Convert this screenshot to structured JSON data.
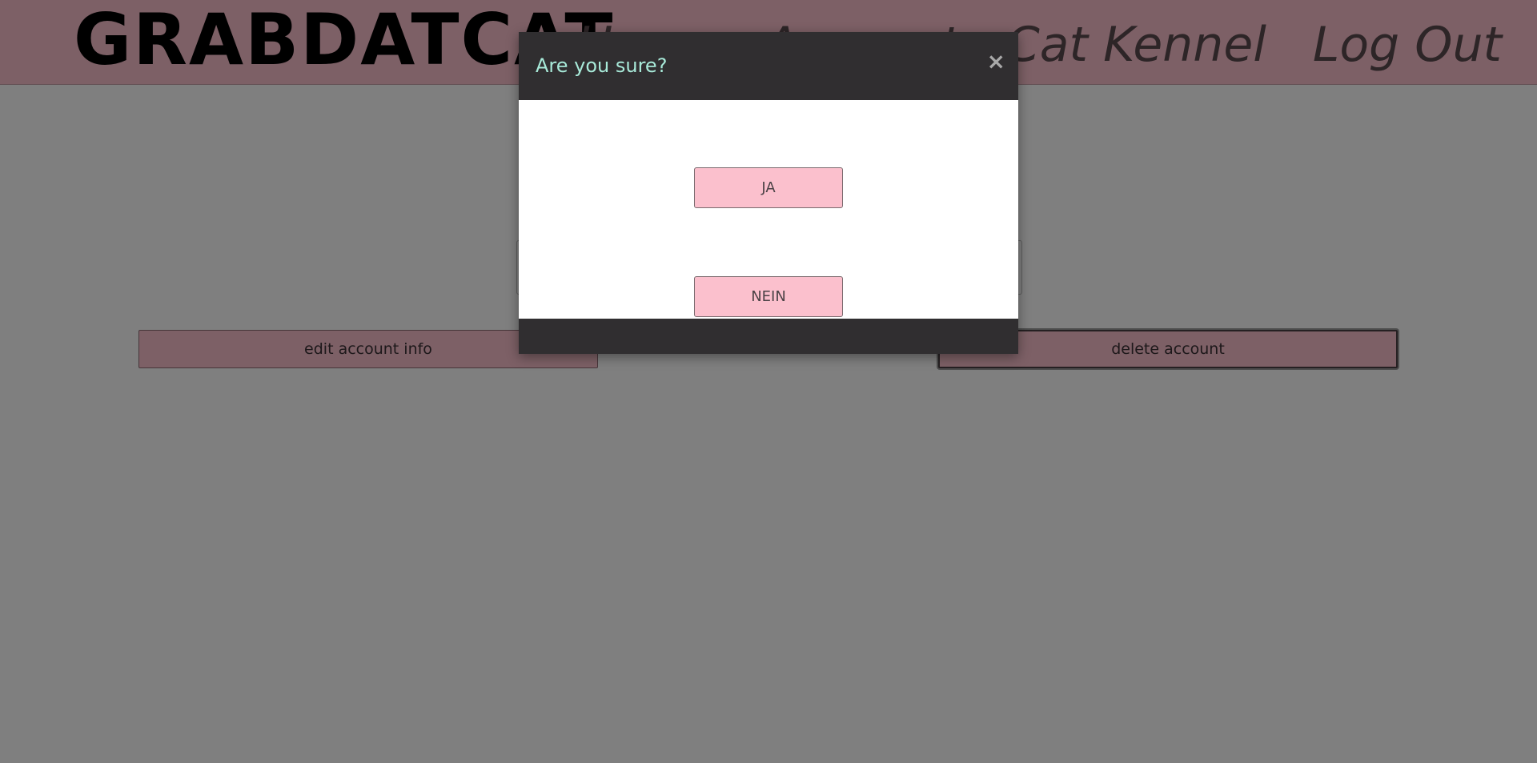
{
  "navbar": {
    "logo": "GRABDATCAT",
    "links": [
      "Home",
      "Account",
      "Cat Kennel",
      "Log Out"
    ]
  },
  "account": {
    "edit_label": "edit account info",
    "delete_label": "delete account"
  },
  "modal": {
    "title": "Are you sure?",
    "close_symbol": "×",
    "yes_label": "JA",
    "no_label": "NEIN"
  },
  "colors": {
    "navbar_bg": "#fbc0cd",
    "modal_header_bg": "#302e30",
    "modal_title": "#a8ead9",
    "button_bg": "#fbc0cd"
  }
}
